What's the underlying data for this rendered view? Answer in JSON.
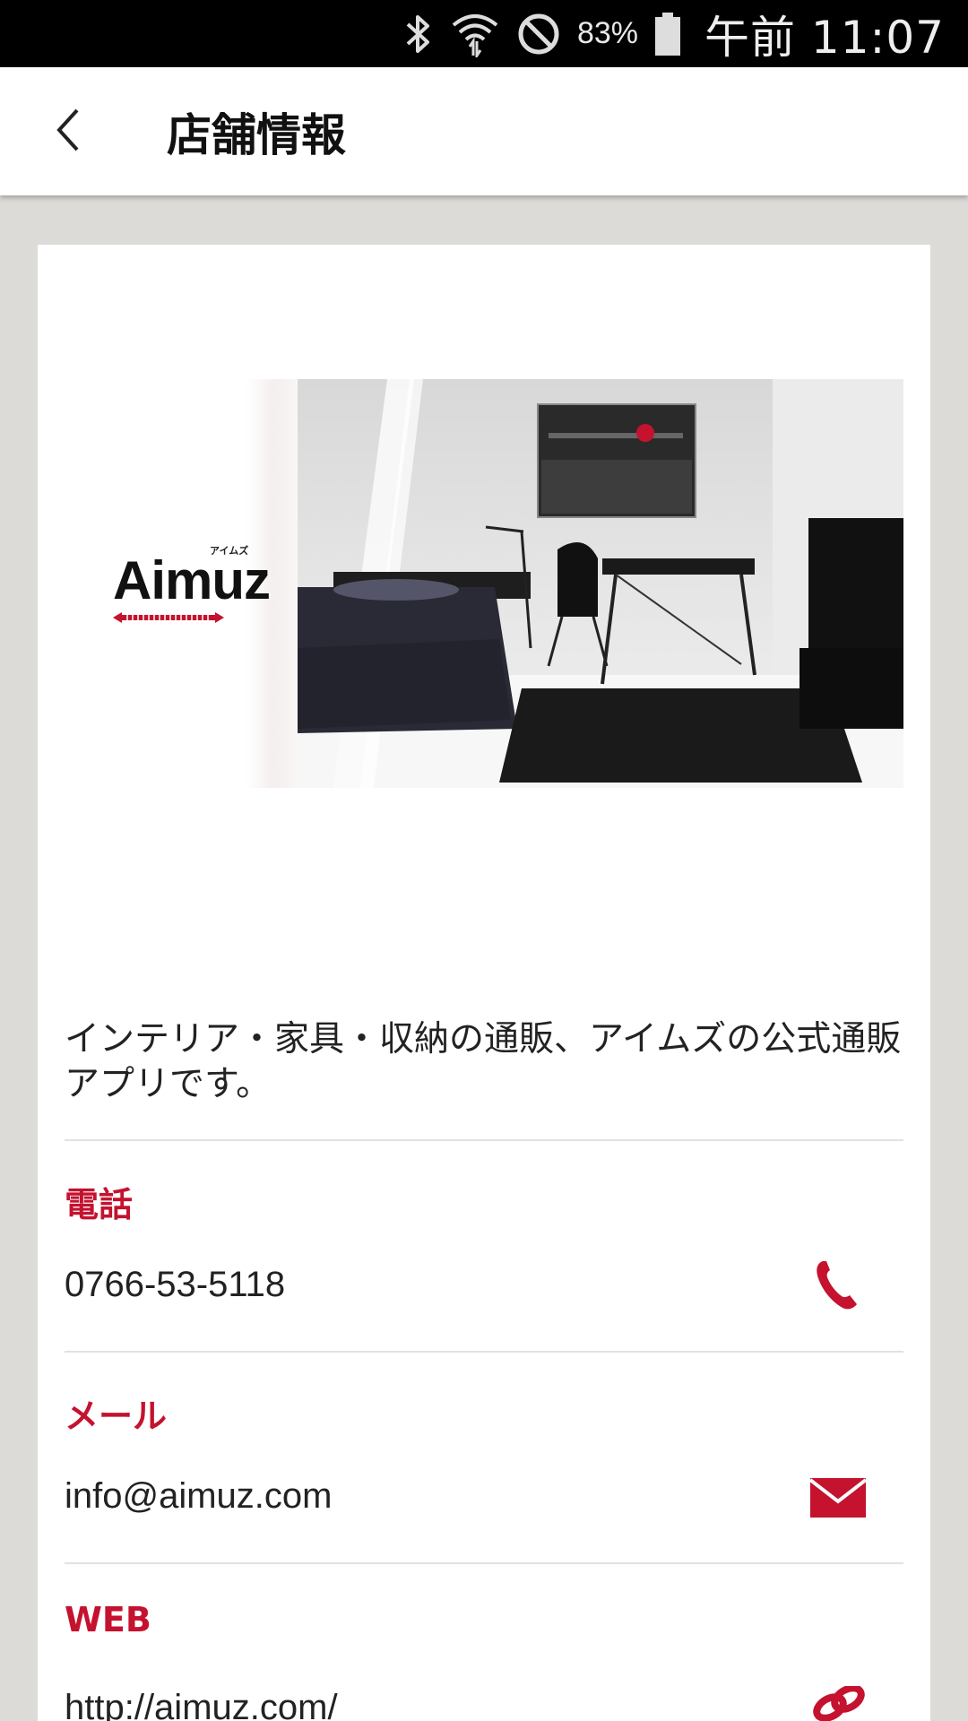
{
  "status_bar": {
    "battery_percent": "83%",
    "time": "午前 11:07",
    "icons": [
      "bluetooth-icon",
      "wifi-icon",
      "do-not-disturb-icon",
      "battery-icon"
    ]
  },
  "app_bar": {
    "back_icon": "chevron-left-icon",
    "title": "店舗情報"
  },
  "banner": {
    "logo_text": "Aimuz",
    "logo_kana": "アイムズ"
  },
  "description": "インテリア・家具・収納の通販、アイムズの公式通販アプリです。",
  "contacts": {
    "phone": {
      "label": "電話",
      "value": "0766-53-5118",
      "icon": "phone-icon"
    },
    "email": {
      "label": "メール",
      "value": "info@aimuz.com",
      "icon": "mail-icon"
    },
    "web": {
      "label": "WEB",
      "value": "http://aimuz.com/",
      "icon": "link-icon"
    }
  },
  "colors": {
    "accent": "#c4122f",
    "page_background": "#dcdbd7",
    "status_bar": "#000000"
  }
}
